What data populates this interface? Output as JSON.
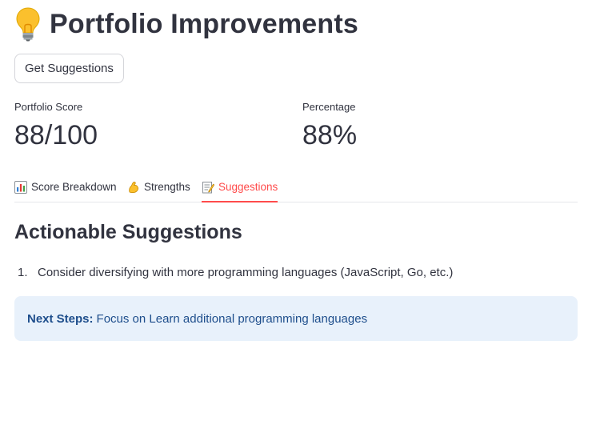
{
  "header": {
    "title": "Portfolio Improvements",
    "title_icon": "lightbulb-icon"
  },
  "actions": {
    "get_suggestions_label": "Get Suggestions"
  },
  "metrics": [
    {
      "label": "Portfolio Score",
      "value": "88/100"
    },
    {
      "label": "Percentage",
      "value": "88%"
    }
  ],
  "tabs": [
    {
      "label": "Score Breakdown",
      "icon": "bar-chart-icon",
      "active": false
    },
    {
      "label": "Strengths",
      "icon": "flexed-biceps-icon",
      "active": false
    },
    {
      "label": "Suggestions",
      "icon": "memo-icon",
      "active": true
    }
  ],
  "suggestions": {
    "heading": "Actionable Suggestions",
    "items": [
      {
        "number": "1.",
        "text": "Consider diversifying with more programming languages (JavaScript, Go, etc.)"
      }
    ],
    "next_steps": {
      "label": "Next Steps:",
      "text": "Focus on Learn additional programming languages"
    }
  },
  "colors": {
    "accent": "#ff4b4b",
    "text": "#31333f",
    "info_background": "#e8f1fb",
    "info_text": "#1e4e8c"
  }
}
